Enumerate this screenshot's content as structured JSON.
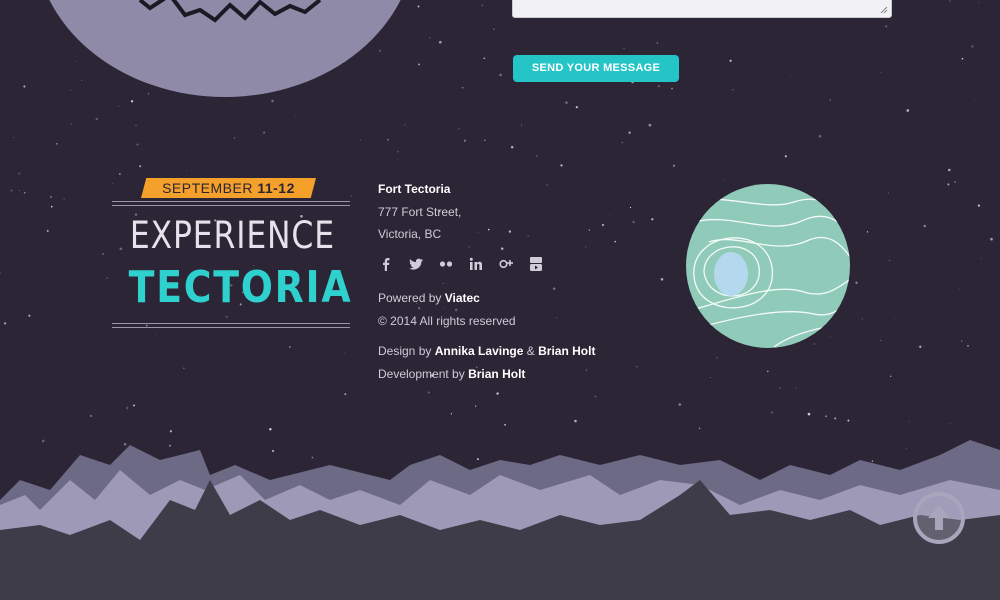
{
  "contact_form": {
    "message_value": "",
    "submit_label": "SEND YOUR MESSAGE"
  },
  "event_badge": {
    "date_prefix": "SEPTEMBER",
    "date_range": "11-12",
    "title_line1": "EXPERIENCE",
    "title_line2": "TECTORIA"
  },
  "footer": {
    "venue": "Fort Tectoria",
    "address_line1": "777 Fort Street,",
    "address_line2": "Victoria, BC",
    "social_icons": [
      "facebook-icon",
      "twitter-icon",
      "flickr-icon",
      "linkedin-icon",
      "google-plus-icon",
      "youtube-icon"
    ],
    "powered_prefix": "Powered by",
    "powered_by": "Viatec",
    "copyright": "© 2014 All rights reserved",
    "design_prefix": "Design by",
    "designer1": "Annika Lavinge",
    "design_and": "&",
    "designer2": "Brian Holt",
    "dev_prefix": "Development by",
    "developer": "Brian Holt"
  },
  "colors": {
    "background": "#2b2535",
    "accent_teal": "#25c4c6",
    "ribbon_orange": "#f5a02a",
    "planet_green": "#8fcbb8",
    "moon_lavender": "#8e8aa8",
    "mountain_front": "#3e3c48",
    "mountain_back": "#6d6a86"
  },
  "back_to_top_icon": "arrow-up-circle-icon"
}
